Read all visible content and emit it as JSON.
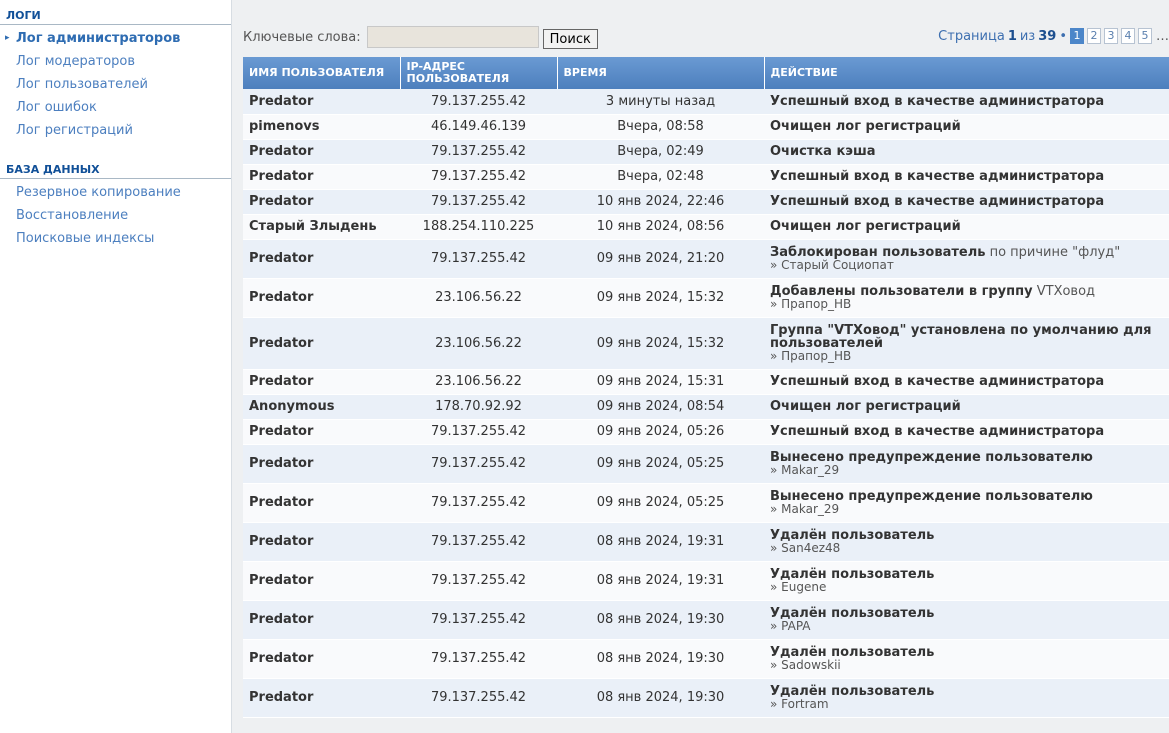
{
  "sidebar": {
    "sections": [
      {
        "title": "ЛОГИ",
        "items": [
          {
            "label": "Лог администраторов",
            "active": true
          },
          {
            "label": "Лог модераторов",
            "active": false
          },
          {
            "label": "Лог пользователей",
            "active": false
          },
          {
            "label": "Лог ошибок",
            "active": false
          },
          {
            "label": "Лог регистраций",
            "active": false
          }
        ]
      },
      {
        "title": "БАЗА ДАННЫХ",
        "items": [
          {
            "label": "Резервное копирование",
            "active": false
          },
          {
            "label": "Восстановление",
            "active": false
          },
          {
            "label": "Поисковые индексы",
            "active": false
          }
        ]
      }
    ]
  },
  "search": {
    "label": "Ключевые слова:",
    "value": "",
    "button": "Поиск"
  },
  "pagination": {
    "prefix": "Страница",
    "current": "1",
    "of": "из",
    "total": "39",
    "bullet": "•",
    "pages": [
      "1",
      "2",
      "3",
      "4",
      "5"
    ],
    "ellipsis": "…"
  },
  "table": {
    "headers": [
      "ИМЯ ПОЛЬЗОВАТЕЛЯ",
      "IP-АДРЕС ПОЛЬЗОВАТЕЛЯ",
      "ВРЕМЯ",
      "ДЕЙСТВИЕ"
    ],
    "rows": [
      {
        "user": "Predator",
        "color": "red",
        "ip": "79.137.255.42",
        "time": "3 минуты назад",
        "action": "Успешный вход в качестве администратора",
        "extra": "",
        "sub": ""
      },
      {
        "user": "pimenovs",
        "color": "green",
        "ip": "46.149.46.139",
        "time": "Вчера, 08:58",
        "action": "Очищен лог регистраций",
        "extra": "",
        "sub": ""
      },
      {
        "user": "Predator",
        "color": "red",
        "ip": "79.137.255.42",
        "time": "Вчера, 02:49",
        "action": "Очистка кэша",
        "extra": "",
        "sub": ""
      },
      {
        "user": "Predator",
        "color": "red",
        "ip": "79.137.255.42",
        "time": "Вчера, 02:48",
        "action": "Успешный вход в качестве администратора",
        "extra": "",
        "sub": ""
      },
      {
        "user": "Predator",
        "color": "red",
        "ip": "79.137.255.42",
        "time": "10 янв 2024, 22:46",
        "action": "Успешный вход в качестве администратора",
        "extra": "",
        "sub": ""
      },
      {
        "user": "Старый Злыдень",
        "color": "green",
        "ip": "188.254.110.225",
        "time": "10 янв 2024, 08:56",
        "action": "Очищен лог регистраций",
        "extra": "",
        "sub": ""
      },
      {
        "user": "Predator",
        "color": "red",
        "ip": "79.137.255.42",
        "time": "09 янв 2024, 21:20",
        "action": "Заблокирован пользователь",
        "extra": " по причине \"флуд\"",
        "sub": "» Старый Социопат"
      },
      {
        "user": "Predator",
        "color": "red",
        "ip": "23.106.56.22",
        "time": "09 янв 2024, 15:32",
        "action": "Добавлены пользователи в группу",
        "extra": " VTXовод",
        "sub": "» Прапор_НВ"
      },
      {
        "user": "Predator",
        "color": "red",
        "ip": "23.106.56.22",
        "time": "09 янв 2024, 15:32",
        "action": "Группа \"VTXовод\" установлена по умолчанию для пользователей",
        "extra": "",
        "sub": "» Прапор_НВ"
      },
      {
        "user": "Predator",
        "color": "red",
        "ip": "23.106.56.22",
        "time": "09 янв 2024, 15:31",
        "action": "Успешный вход в качестве администратора",
        "extra": "",
        "sub": ""
      },
      {
        "user": "Anonymous",
        "color": "orange",
        "ip": "178.70.92.92",
        "time": "09 янв 2024, 08:54",
        "action": "Очищен лог регистраций",
        "extra": "",
        "sub": ""
      },
      {
        "user": "Predator",
        "color": "red",
        "ip": "79.137.255.42",
        "time": "09 янв 2024, 05:26",
        "action": "Успешный вход в качестве администратора",
        "extra": "",
        "sub": ""
      },
      {
        "user": "Predator",
        "color": "red",
        "ip": "79.137.255.42",
        "time": "09 янв 2024, 05:25",
        "action": "Вынесено предупреждение пользователю",
        "extra": "",
        "sub": "» Makar_29"
      },
      {
        "user": "Predator",
        "color": "red",
        "ip": "79.137.255.42",
        "time": "09 янв 2024, 05:25",
        "action": "Вынесено предупреждение пользователю",
        "extra": "",
        "sub": "» Makar_29"
      },
      {
        "user": "Predator",
        "color": "red",
        "ip": "79.137.255.42",
        "time": "08 янв 2024, 19:31",
        "action": "Удалён пользователь",
        "extra": "",
        "sub": "» San4ez48"
      },
      {
        "user": "Predator",
        "color": "red",
        "ip": "79.137.255.42",
        "time": "08 янв 2024, 19:31",
        "action": "Удалён пользователь",
        "extra": "",
        "sub": "» Eugene"
      },
      {
        "user": "Predator",
        "color": "red",
        "ip": "79.137.255.42",
        "time": "08 янв 2024, 19:30",
        "action": "Удалён пользователь",
        "extra": "",
        "sub": "» PAPA"
      },
      {
        "user": "Predator",
        "color": "red",
        "ip": "79.137.255.42",
        "time": "08 янв 2024, 19:30",
        "action": "Удалён пользователь",
        "extra": "",
        "sub": "» Sadowskii"
      },
      {
        "user": "Predator",
        "color": "red",
        "ip": "79.137.255.42",
        "time": "08 янв 2024, 19:30",
        "action": "Удалён пользователь",
        "extra": "",
        "sub": "» Fortram"
      }
    ]
  }
}
